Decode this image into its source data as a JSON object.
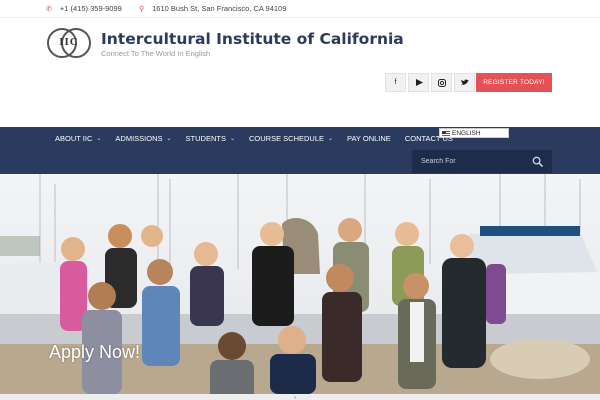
{
  "topbar": {
    "phone": "+1 (415) 359-9099",
    "address": "1610 Bush St, San Francisco, CA 94109",
    "phone_icon": "phone-icon",
    "address_icon": "map-marker-icon"
  },
  "header": {
    "logo_text": "IIC",
    "title": "Intercultural Institute of California",
    "tagline": "Connect To The World In English"
  },
  "social": {
    "facebook": "f",
    "youtube": "▶",
    "instagram": "◎",
    "twitter": "🐦",
    "register_label": "REGISTER TODAY!"
  },
  "nav": {
    "items": [
      {
        "label": "ABOUT IIC",
        "has_dropdown": true
      },
      {
        "label": "ADMISSIONS",
        "has_dropdown": true
      },
      {
        "label": "STUDENTS",
        "has_dropdown": true
      },
      {
        "label": "COURSE SCHEDULE",
        "has_dropdown": true
      },
      {
        "label": "PAY ONLINE",
        "has_dropdown": false
      },
      {
        "label": "CONTACT US",
        "has_dropdown": false
      }
    ],
    "chevron": "⌄",
    "language": "ENGLISH",
    "search_placeholder": "Search For"
  },
  "hero": {
    "title": "Apply Now!"
  },
  "colors": {
    "navy": "#2a3b5f",
    "accent_red": "#e45156",
    "title_blue": "#2c3b5c"
  }
}
